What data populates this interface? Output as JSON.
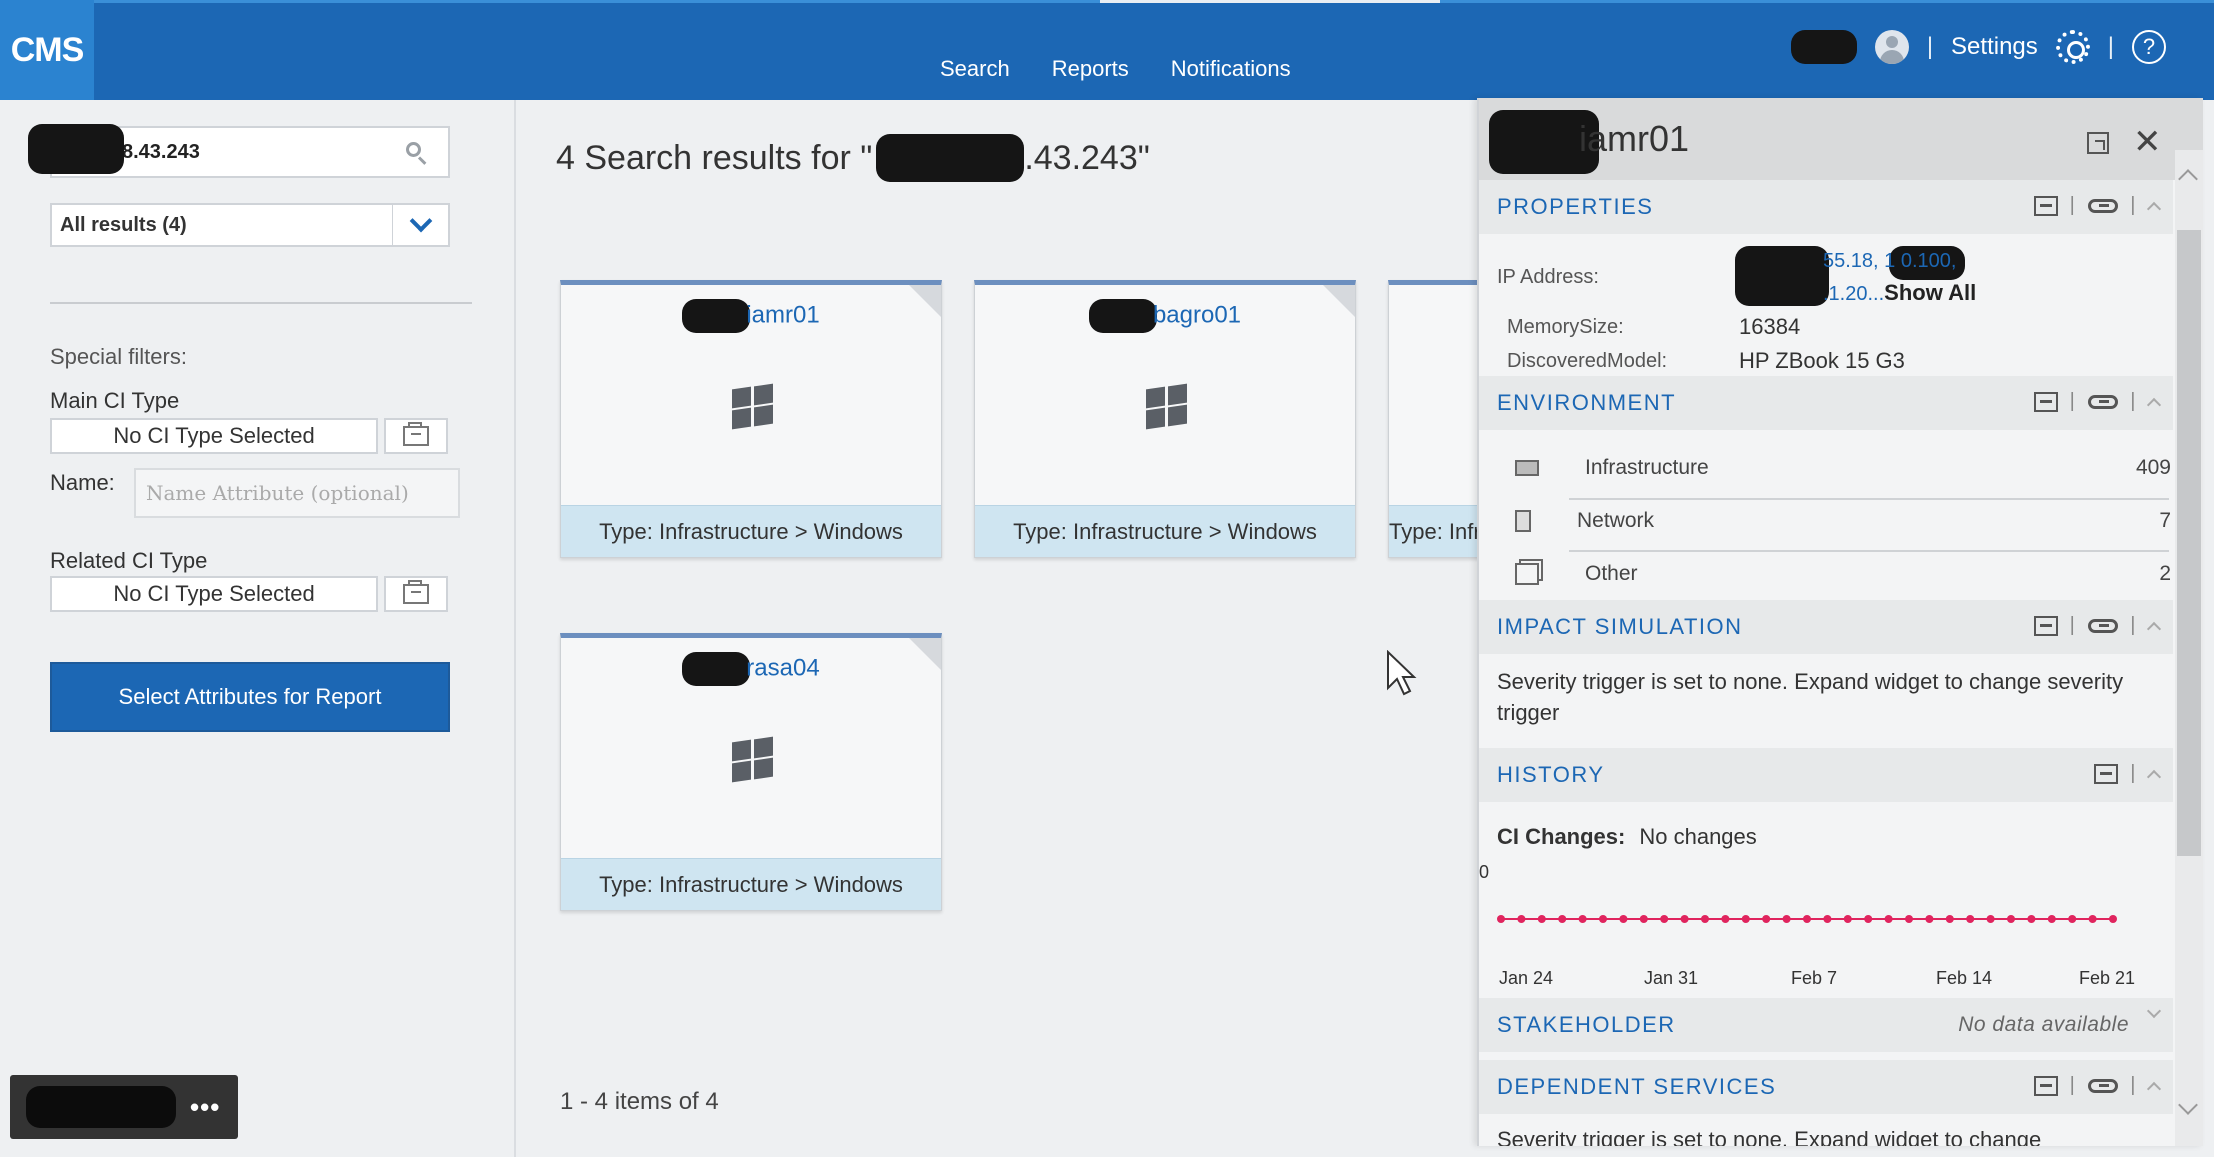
{
  "app": {
    "logo": "CMS"
  },
  "nav": {
    "items": [
      "Search",
      "Reports",
      "Notifications"
    ]
  },
  "topright": {
    "settings_label": "Settings",
    "separator": "|",
    "help_glyph": "?"
  },
  "left": {
    "search_value": "8.43.243",
    "results_filter": "All results (4)",
    "special_filters_label": "Special filters:",
    "main_ci_type_label": "Main CI Type",
    "main_ci_type_value": "No CI Type Selected",
    "name_label": "Name:",
    "name_placeholder": "Name Attribute (optional)",
    "related_ci_type_label": "Related CI Type",
    "related_ci_type_value": "No CI Type Selected",
    "report_button": "Select Attributes for Report",
    "more_glyph": "•••"
  },
  "results": {
    "title_prefix": "4 Search results for \"",
    "title_suffix": ".43.243\"",
    "cards": [
      {
        "name": "iamr01",
        "type": "Type: Infrastructure > Windows"
      },
      {
        "name": "bagro01",
        "type": "Type: Infrastructure > Windows"
      },
      {
        "name": "",
        "type": "Type: Infrastructure > Windows"
      },
      {
        "name": "rasa04",
        "type": "Type: Infrastructure > Windows"
      }
    ],
    "pager": "1 - 4 items of 4"
  },
  "detail": {
    "title": "iamr01",
    "close_glyph": "✕",
    "properties": {
      "header": "PROPERTIES",
      "ip_label": "IP Address:",
      "ip_line1": "55.18, 1            0.100,",
      "ip_line2": ".1.20...",
      "show_all": "Show All",
      "memory_label": "MemorySize:",
      "memory_value": "16384",
      "model_label": "DiscoveredModel:",
      "model_value": "HP ZBook 15 G3"
    },
    "environment": {
      "header": "ENVIRONMENT",
      "rows": [
        {
          "label": "Infrastructure",
          "count": "409",
          "icon": "computer-icon"
        },
        {
          "label": "Network",
          "count": "7",
          "icon": "network-device-icon"
        },
        {
          "label": "Other",
          "count": "2",
          "icon": "stack-icon"
        }
      ]
    },
    "impact": {
      "header": "IMPACT SIMULATION",
      "text": "Severity trigger is set to none. Expand widget to change severity trigger"
    },
    "history": {
      "header": "HISTORY",
      "ci_changes_label": "CI Changes:",
      "ci_changes_value": "No changes",
      "zero_label": "0",
      "x_ticks": [
        "Jan 24",
        "Jan 31",
        "Feb 7",
        "Feb 14",
        "Feb 21"
      ],
      "series_color": "#e0245e"
    },
    "stakeholder": {
      "header": "STAKEHOLDER",
      "status": "No data available"
    },
    "dependent": {
      "header": "DEPENDENT SERVICES",
      "text": "Severity trigger is set to none. Expand widget to change"
    }
  },
  "colors": {
    "brand": "#1c67b4",
    "logo_bg": "#2b83d0",
    "card_type_bg": "#cfe5f1"
  }
}
